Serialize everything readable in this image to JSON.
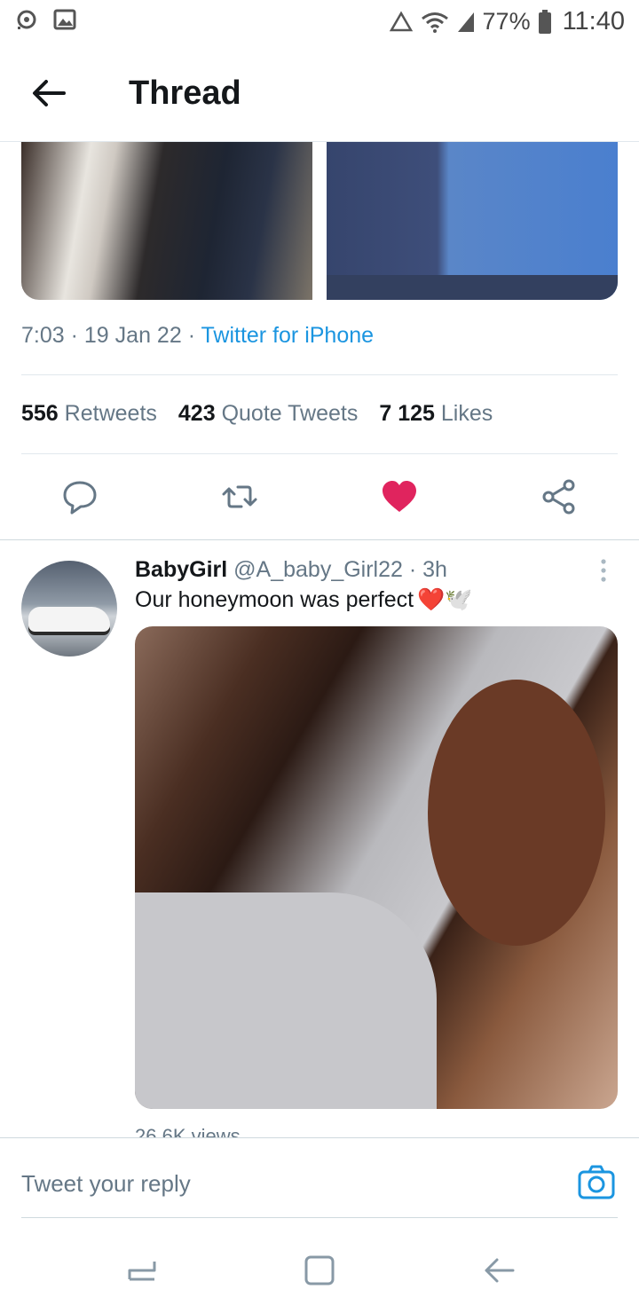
{
  "status_bar": {
    "battery": "77%",
    "time": "11:40"
  },
  "header": {
    "title": "Thread"
  },
  "tweet": {
    "time": "7:03",
    "date": "19 Jan 22",
    "source": "Twitter for iPhone",
    "stats": {
      "retweets_count": "556",
      "retweets_label": "Retweets",
      "quotes_count": "423",
      "quotes_label": "Quote Tweets",
      "likes_count": "7 125",
      "likes_label": "Likes"
    },
    "liked": true
  },
  "reply_tweet": {
    "name": "BabyGirl",
    "handle": "@A_baby_Girl22",
    "age": "3h",
    "text": "Our honeymoon was perfect",
    "emoji": "❤️🕊️",
    "views": "26.6K views"
  },
  "reply_bar": {
    "placeholder": "Tweet your reply"
  },
  "colors": {
    "link": "#1b95e0",
    "like": "#e0245e",
    "secondary_text": "#657786"
  },
  "icons": {
    "back": "back-arrow-icon",
    "reply": "comment-icon",
    "retweet": "retweet-icon",
    "like": "heart-icon",
    "share": "share-icon",
    "camera": "camera-icon"
  }
}
